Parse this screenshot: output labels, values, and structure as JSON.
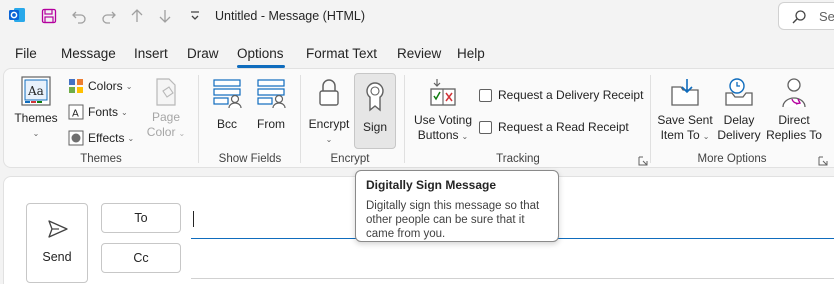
{
  "titlebar": {
    "title": "Untitled  -  Message (HTML)",
    "search_label": "Se"
  },
  "tabs": [
    "File",
    "Message",
    "Insert",
    "Draw",
    "Options",
    "Format Text",
    "Review",
    "Help"
  ],
  "active_tab": "Options",
  "ribbon": {
    "themes_group": {
      "label": "Themes",
      "themes_button": "Themes",
      "colors_button": "Colors",
      "fonts_button": "Fonts",
      "effects_button": "Effects",
      "page_color_line1": "Page",
      "page_color_line2": "Color"
    },
    "show_fields_group": {
      "label": "Show Fields",
      "bcc_button": "Bcc",
      "from_button": "From"
    },
    "encrypt_group": {
      "label": "Encrypt",
      "encrypt_button": "Encrypt",
      "sign_button": "Sign"
    },
    "tracking_group": {
      "label": "Tracking",
      "use_voting_line1": "Use Voting",
      "use_voting_line2": "Buttons",
      "delivery_receipt": "Request a Delivery Receipt",
      "read_receipt": "Request a Read Receipt"
    },
    "more_options_group": {
      "label": "More Options",
      "save_sent_line1": "Save Sent",
      "save_sent_line2": "Item To",
      "delay_line1": "Delay",
      "delay_line2": "Delivery",
      "direct_line1": "Direct",
      "direct_line2": "Replies To"
    }
  },
  "compose": {
    "send_label": "Send",
    "to_label": "To",
    "cc_label": "Cc"
  },
  "tooltip": {
    "title": "Digitally Sign Message",
    "body": "Digitally sign this message so that other people can be sure that it came from you."
  },
  "colors": {
    "accent": "#0f6cbd",
    "outlook_blue": "#0a64d6",
    "save_purple": "#b4009e"
  }
}
